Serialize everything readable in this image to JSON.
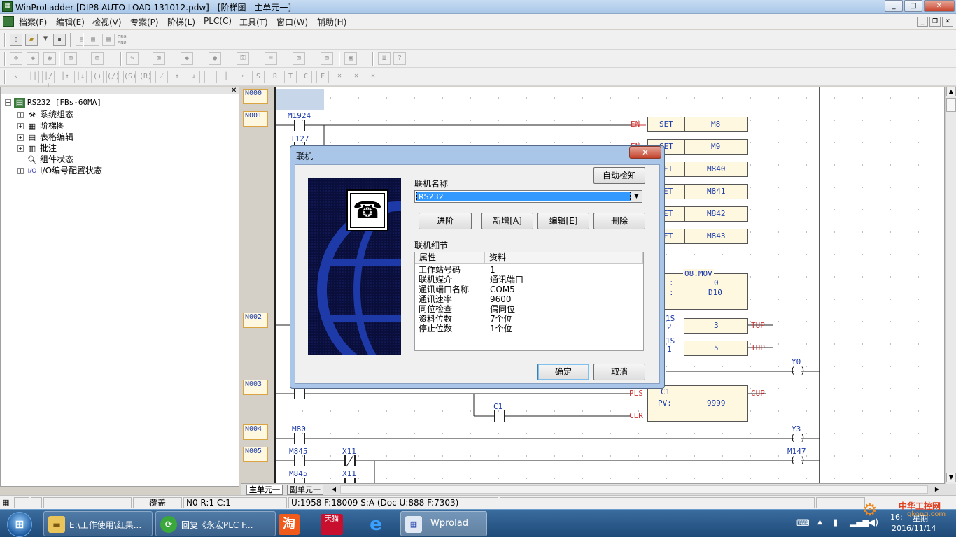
{
  "app": {
    "title": "WinProLadder [DIP8 AUTO LOAD 131012.pdw] - [阶梯图 - 主单元一]",
    "win_min": "_",
    "win_max": "□",
    "win_close": "✕",
    "mdi_min": "_",
    "mdi_max": "❐",
    "mdi_close": "✕"
  },
  "menu": [
    "档案(F)",
    "编辑(E)",
    "检视(V)",
    "专案(P)",
    "阶梯(L)",
    "PLC(C)",
    "工具(T)",
    "窗口(W)",
    "辅助(H)"
  ],
  "toolbar1": {
    "organd_top": "ORG",
    "organd_bottom": "AND"
  },
  "tree": {
    "root": "RS232 [FBs-60MA]",
    "items": [
      "系统组态",
      "阶梯图",
      "表格编辑",
      "批注",
      "组件状态",
      "I/O编号配置状态"
    ]
  },
  "networks": [
    "N000",
    "N001",
    "N002",
    "N003",
    "N004",
    "N005"
  ],
  "ladder": {
    "contacts": [
      "M1924",
      "T127",
      "C1",
      "M80",
      "M845",
      "X11",
      "M845",
      "X11"
    ],
    "en_labels": [
      "EN",
      "EN"
    ],
    "set_blocks": [
      {
        "op": "SET",
        "dev": "M8"
      },
      {
        "op": "SET",
        "dev": "M9"
      },
      {
        "op": "ET",
        "dev": "M840"
      },
      {
        "op": "ET",
        "dev": "M841"
      },
      {
        "op": "ET",
        "dev": "M842"
      },
      {
        "op": "ET",
        "dev": "M843"
      }
    ],
    "mov_block": {
      "title": "08.MOV",
      "s_label": ":",
      "s_val": "0",
      "d_label": ":",
      "d_val": "D10"
    },
    "timers": [
      {
        "base": "1S",
        "num": "2",
        "value": "3",
        "out": "TUP"
      },
      {
        "base": "1S",
        "num": "1",
        "value": "5",
        "out": "TUP"
      }
    ],
    "counter": {
      "name": "C1",
      "pv_label": "PV:",
      "pv": "9999",
      "pls": "PLS",
      "clr": "CLR",
      "out": "CUP"
    },
    "coils": [
      "Y0",
      "Y3",
      "M147"
    ]
  },
  "tabs": [
    "主单元一",
    "副单元一"
  ],
  "dialog": {
    "title": "联机",
    "close": "✕",
    "auto_detect": "自动检知",
    "name_label": "联机名称",
    "name_value": "RS232",
    "btn_advanced": "进阶",
    "btn_add": "新增[A]",
    "btn_edit": "编辑[E]",
    "btn_delete": "删除",
    "detail_label": "联机细节",
    "col_attr": "属性",
    "col_data": "资料",
    "rows": [
      {
        "k": "工作站号码",
        "v": "1"
      },
      {
        "k": "联机媒介",
        "v": "通讯端口"
      },
      {
        "k": "通讯端口名称",
        "v": "COM5"
      },
      {
        "k": "通讯速率",
        "v": "9600"
      },
      {
        "k": "同位检查",
        "v": "偶同位"
      },
      {
        "k": "资料位数",
        "v": "7个位"
      },
      {
        "k": "停止位数",
        "v": "1个位"
      }
    ],
    "ok": "确定",
    "cancel": "取消"
  },
  "status": {
    "mode": "覆盖",
    "pos": "N0 R:1 C:1",
    "mem": "U:1958 F:18009 S:A (Doc U:888 F:7303)"
  },
  "taskbar": {
    "task1": "E:\\工作使用\\红果...",
    "task2": "回复《永宏PLC F...",
    "task3": "Wprolad",
    "pin_taobao": "淘",
    "pin_tmall": "天猫",
    "tray_time": "16:",
    "tray_weekday": "星期",
    "tray_date": "2016/11/14",
    "watermark": "中华工控网",
    "watermark_url": "gkong.com"
  }
}
